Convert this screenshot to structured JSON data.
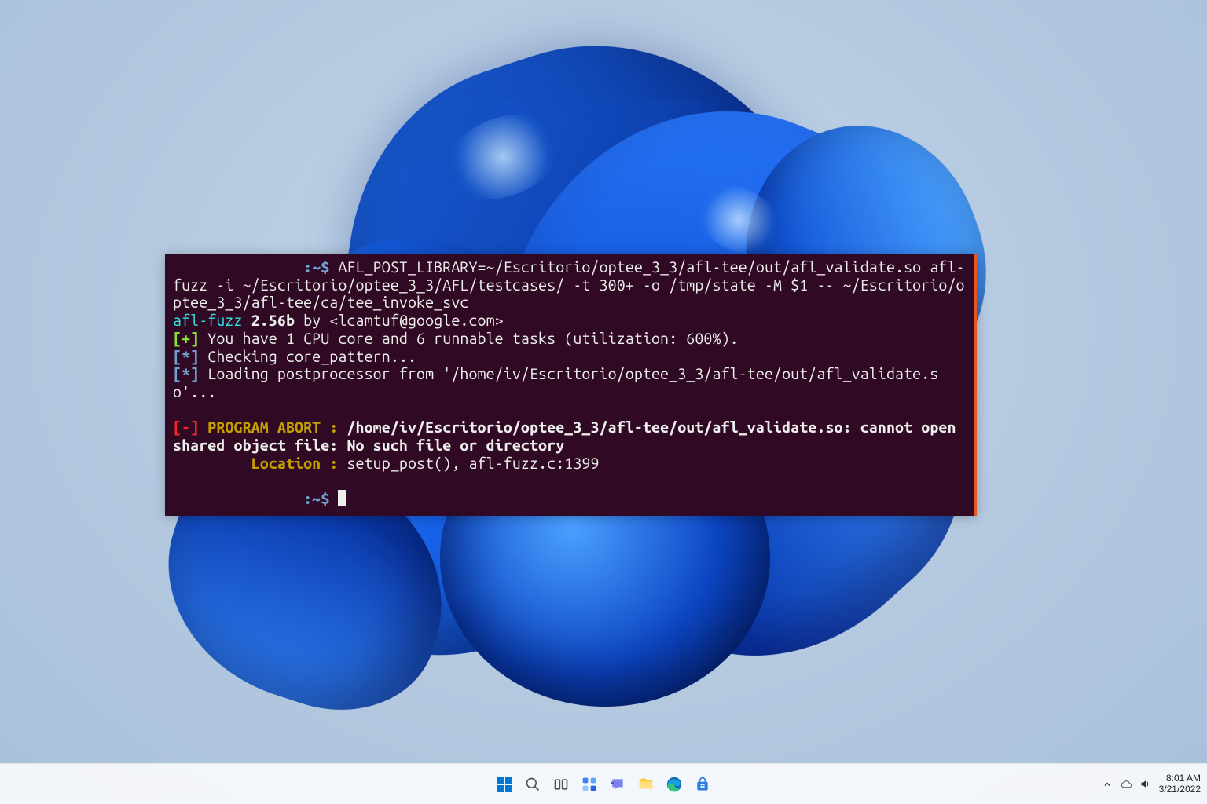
{
  "terminal": {
    "prompt1": ":~$ ",
    "cmd_part1": "AFL_POST_LIBRARY=~/Escritorio/optee_3_3/afl-tee/out/afl_validate.so afl-fuzz -i ~/Escritorio/optee_3_3/AFL/testcases/ -t 300+ -o /tmp/state -M $1 -- ~/Escritorio/optee_3_3/afl-tee/ca/tee_invoke_svc",
    "prog": "afl-fuzz",
    "ver": " 2.56b",
    "byline": " by <lcamtuf@google.com>",
    "plus_open": "[+]",
    "cpu_line": " You have 1 CPU core and 6 runnable tasks (utilization: 600%).",
    "star1": "[*]",
    "check_line": " Checking core_pattern...",
    "star2": "[*]",
    "load_line": " Loading postprocessor from '/home/iv/Escritorio/optee_3_3/afl-tee/out/afl_validate.so'...",
    "dash_open": "[-] ",
    "abort_label": "PROGRAM ABORT : ",
    "abort_msg": "/home/iv/Escritorio/optee_3_3/afl-tee/out/afl_validate.so: cannot open shared object file: No such file or directory",
    "loc_label": "         Location : ",
    "loc_val": "setup_post(), afl-fuzz.c:1399",
    "prompt_host_pad": "               ",
    "prompt2": ":~$ "
  },
  "taskbar": {
    "time": "8:01 AM",
    "date": "3/21/2022"
  }
}
